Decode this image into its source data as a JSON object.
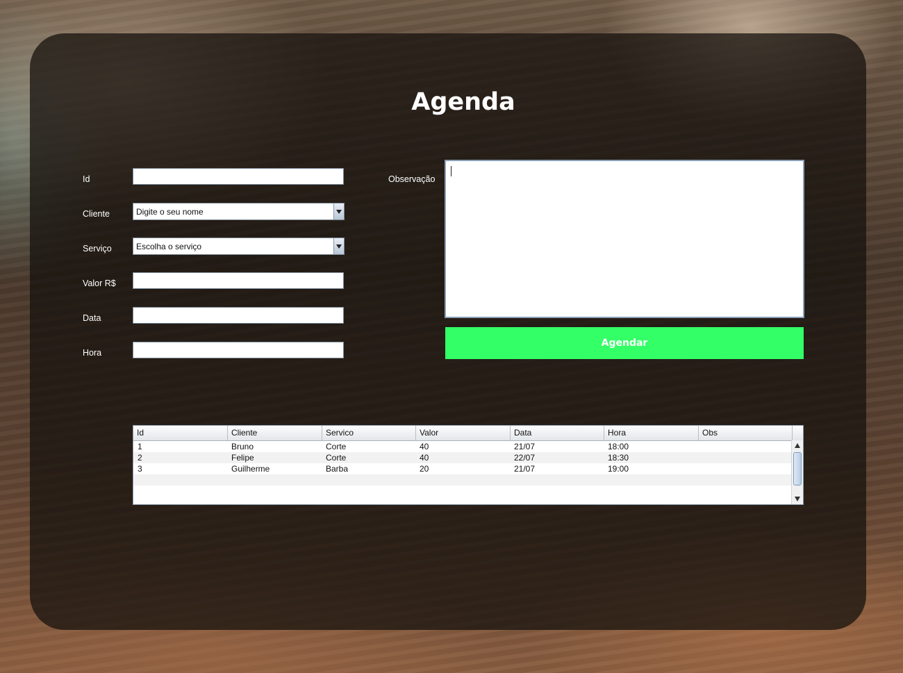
{
  "title": "Agenda",
  "form": {
    "id_label": "Id",
    "cliente_label": "Cliente",
    "cliente_selected": "Digite o seu nome",
    "servico_label": "Serviço",
    "servico_selected": "Escolha o serviço",
    "valor_label": "Valor R$",
    "data_label": "Data",
    "hora_label": "Hora",
    "obs_label": "Observação",
    "submit_label": "Agendar"
  },
  "colors": {
    "accent_button": "#33ff66",
    "panel": "#16110d"
  },
  "table": {
    "columns": [
      "Id",
      "Cliente",
      "Servico",
      "Valor",
      "Data",
      "Hora",
      "Obs"
    ],
    "rows": [
      [
        "1",
        "Bruno",
        "Corte",
        "40",
        "21/07",
        "18:00",
        ""
      ],
      [
        "2",
        "Felipe",
        "Corte",
        "40",
        "22/07",
        "18:30",
        ""
      ],
      [
        "3",
        "Guilherme",
        "Barba",
        "20",
        "21/07",
        "19:00",
        ""
      ]
    ]
  }
}
